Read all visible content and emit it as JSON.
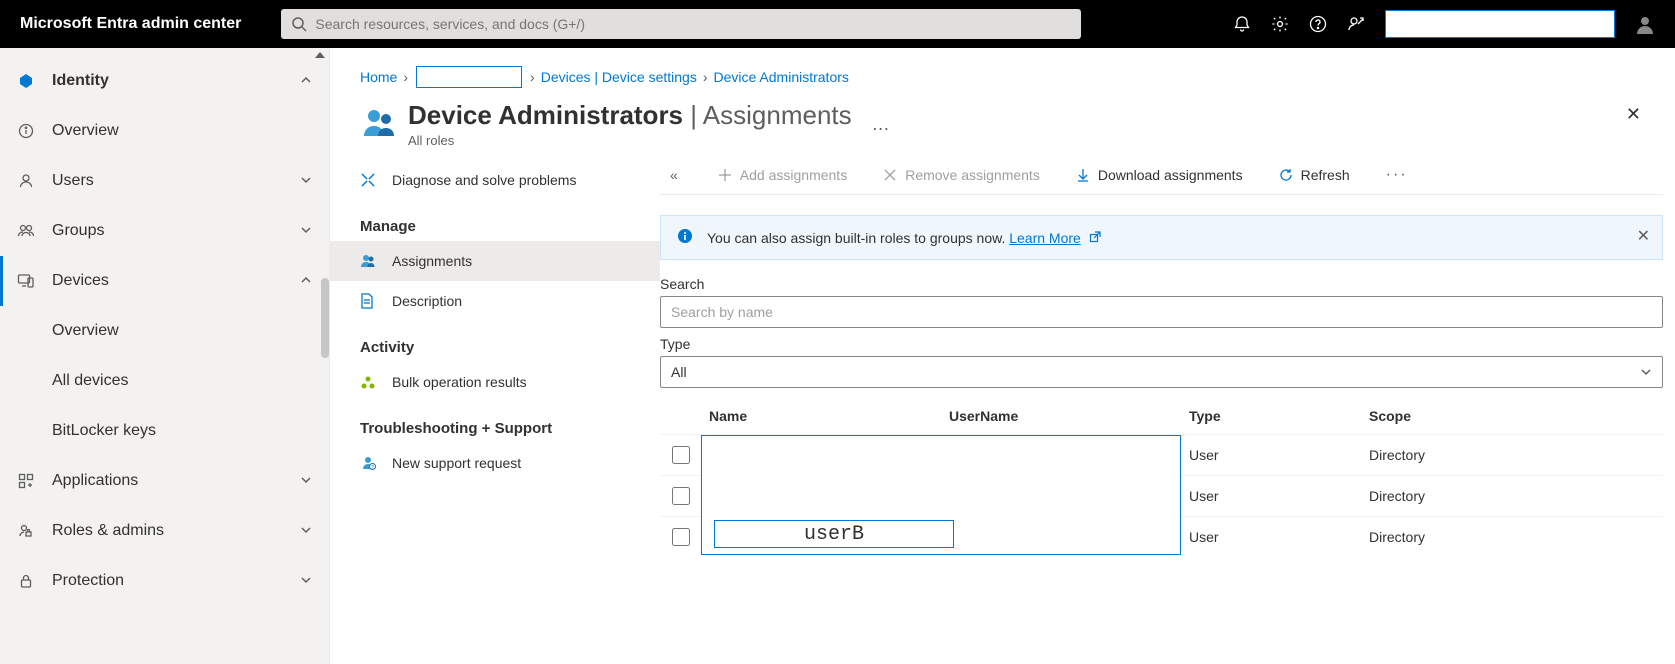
{
  "brand": "Microsoft Entra admin center",
  "search": {
    "placeholder": "Search resources, services, and docs (G+/)"
  },
  "leftnav": {
    "identity": "Identity",
    "overview": "Overview",
    "users": "Users",
    "groups": "Groups",
    "devices": "Devices",
    "devices_overview": "Overview",
    "devices_all": "All devices",
    "devices_bitlocker": "BitLocker keys",
    "applications": "Applications",
    "roles": "Roles & admins",
    "protection": "Protection"
  },
  "breadcrumb": {
    "home": "Home",
    "devices": "Devices | Device settings",
    "current": "Device Administrators"
  },
  "page": {
    "title_strong": "Device Administrators",
    "title_light": " | Assignments",
    "subtitle": "All roles"
  },
  "subnav": {
    "diagnose": "Diagnose and solve problems",
    "section_manage": "Manage",
    "assignments": "Assignments",
    "description": "Description",
    "section_activity": "Activity",
    "bulk": "Bulk operation results",
    "section_troubleshoot": "Troubleshooting + Support",
    "support": "New support request"
  },
  "toolbar": {
    "add": "Add assignments",
    "remove": "Remove assignments",
    "download": "Download assignments",
    "refresh": "Refresh"
  },
  "banner": {
    "text": "You can also assign built-in roles to groups now. ",
    "link": "Learn More"
  },
  "filters": {
    "search_label": "Search",
    "search_placeholder": "Search by name",
    "type_label": "Type",
    "type_value": "All"
  },
  "table": {
    "col_name": "Name",
    "col_username": "UserName",
    "col_type": "Type",
    "col_scope": "Scope",
    "rows": [
      {
        "name": "",
        "username": "",
        "type": "User",
        "scope": "Directory"
      },
      {
        "name": "",
        "username": "",
        "type": "User",
        "scope": "Directory"
      },
      {
        "name": "userB",
        "username": "",
        "type": "User",
        "scope": "Directory"
      }
    ]
  }
}
